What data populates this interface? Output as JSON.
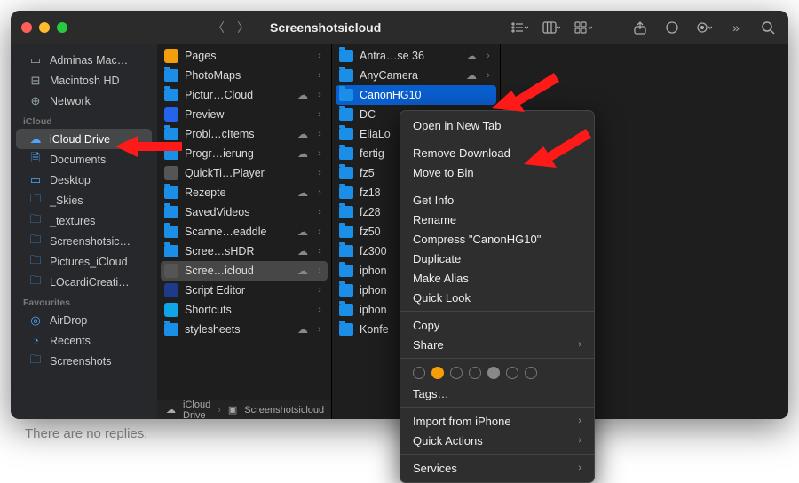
{
  "window": {
    "title": "Screenshotsicloud"
  },
  "path": {
    "seg1": "iCloud Drive",
    "seg2": "Screenshotsicloud"
  },
  "sidebar": {
    "loc0": "Adminas Mac…",
    "loc1": "Macintosh HD",
    "loc2": "Network",
    "sec_icloud": "iCloud",
    "icloud0": "iCloud Drive",
    "icloud1": "Documents",
    "icloud2": "Desktop",
    "icloud3": "_Skies",
    "icloud4": "_textures",
    "icloud5": "Screenshotsic…",
    "icloud6": "Pictures_iCloud",
    "icloud7": "LOcardiCreati…",
    "sec_fav": "Favourites",
    "fav0": "AirDrop",
    "fav1": "Recents",
    "fav2": "Screenshots"
  },
  "col1": {
    "r0": "Pages",
    "r1": "PhotoMaps",
    "r2": "Pictur…Cloud",
    "r3": "Preview",
    "r4": "Probl…cItems",
    "r5": "Progr…ierung",
    "r6": "QuickTi…Player",
    "r7": "Rezepte",
    "r8": "SavedVideos",
    "r9": "Scanne…eaddle",
    "r10": "Scree…sHDR",
    "r11": "Scree…icloud",
    "r12": "Script Editor",
    "r13": "Shortcuts",
    "r14": "stylesheets"
  },
  "col2": {
    "r0": "Antra…se 36",
    "r1": "AnyCamera",
    "r2": "CanonHG10",
    "r3": "DC",
    "r4": "EliaLo",
    "r5": "fertig",
    "r6": "fz5",
    "r7": "fz18",
    "r8": "fz28",
    "r9": "fz50",
    "r10": "fz300",
    "r11": "iphon",
    "r12": "iphon",
    "r13": "iphon",
    "r14": "Konfe"
  },
  "ctx": {
    "i0": "Open in New Tab",
    "i1": "Remove Download",
    "i2": "Move to Bin",
    "i3": "Get Info",
    "i4": "Rename",
    "i5": "Compress \"CanonHG10\"",
    "i6": "Duplicate",
    "i7": "Make Alias",
    "i8": "Quick Look",
    "i9": "Copy",
    "i10": "Share",
    "i11": "Tags…",
    "i12": "Import from iPhone",
    "i13": "Quick Actions",
    "i14": "Services"
  },
  "footer": {
    "no_replies": "There are no replies."
  }
}
